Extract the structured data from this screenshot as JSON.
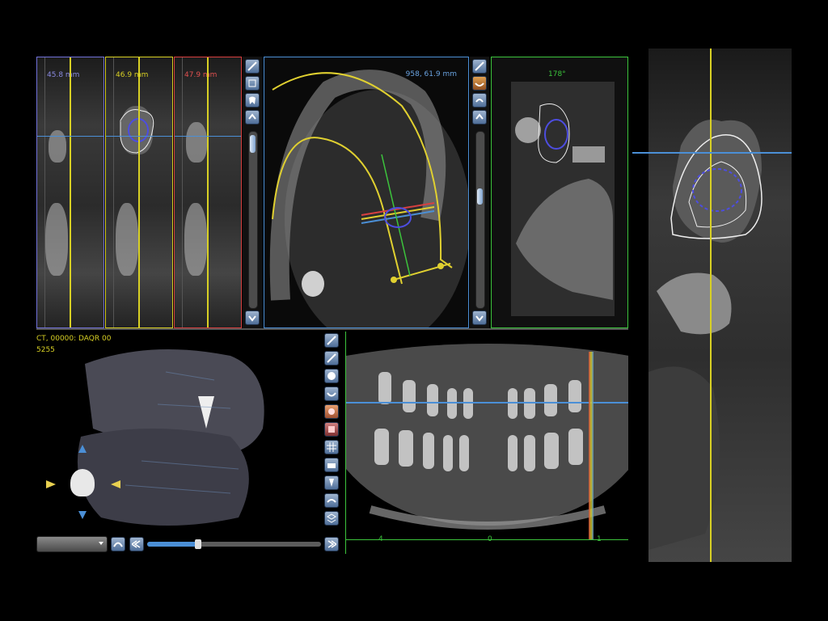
{
  "slices": [
    {
      "value": "45.8 mm",
      "color": "#7070d8"
    },
    {
      "value": "46.9 mm",
      "color": "#d8d024"
    },
    {
      "value": "47.9 mm",
      "color": "#d84040"
    }
  ],
  "axial": {
    "readout": "958, 61.9 mm",
    "border_color": "#4b8fd6"
  },
  "cross_section": {
    "readout": "178°",
    "border_color": "#3cc43c"
  },
  "volume": {
    "line1": "CT, 00000: DAQR 00",
    "line2": "5255"
  },
  "panoramic": {
    "ruler_labels": [
      "4",
      "0",
      "1"
    ]
  },
  "icons": [
    "navigation-icon",
    "layers-icon",
    "tooth-icon",
    "jaw-icon",
    "rotate-icon",
    "skull-icon",
    "face-icon",
    "model-icon",
    "grid-icon",
    "print-icon",
    "implant-icon",
    "nerve-icon"
  ],
  "colors": {
    "accent_yellow": "#d8d024",
    "accent_blue": "#4b8fd6",
    "accent_green": "#3cc43c",
    "accent_red": "#d84040"
  }
}
